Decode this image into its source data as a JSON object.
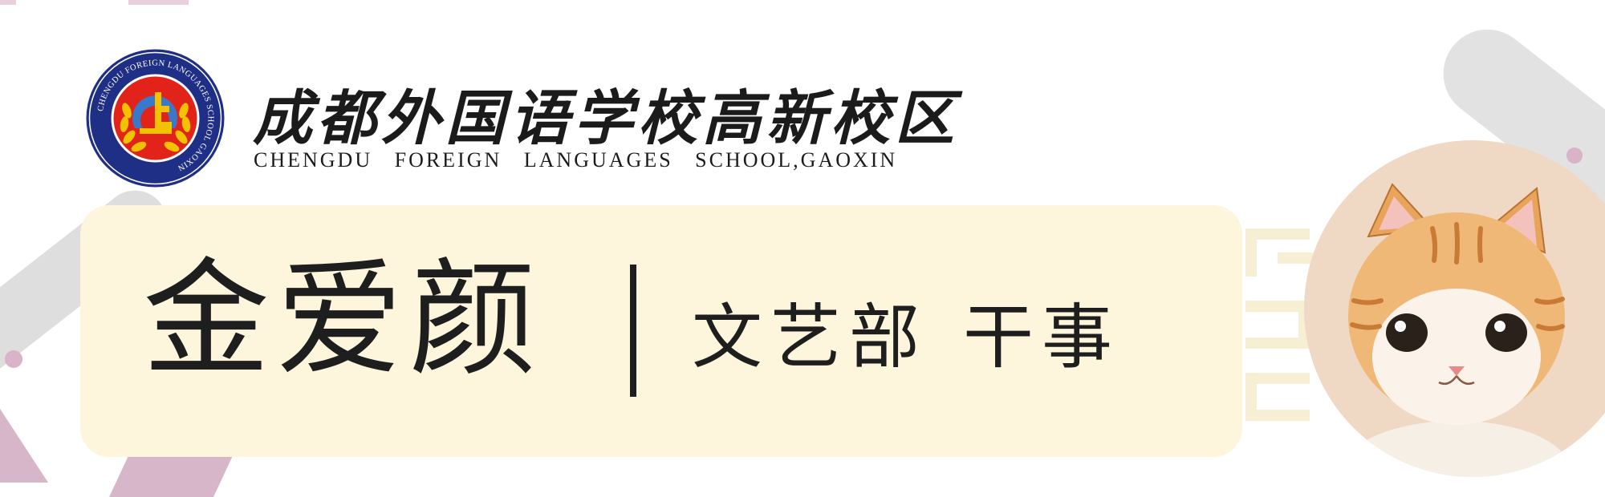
{
  "school": {
    "name_cn": "成都外国语学校高新校区",
    "name_en": "CHENGDU FOREIGN LANGUAGES SCHOOL,GAOXIN"
  },
  "logo": {
    "ring_text": "CHENGDU FOREIGN LANGUAGES SCHOOL GAOXIN",
    "ring_text_cn": "成都外国语学校高新校区",
    "colors": {
      "ring": "#1f2f86",
      "inner": "#e2231a",
      "wreath": "#f2c200",
      "emblem": "#3a78c9"
    }
  },
  "card": {
    "name": "金爱颜",
    "department": "文艺部",
    "position": "干事"
  },
  "avatar": {
    "icon": "cat-icon"
  },
  "colors": {
    "card_bg": "#fdf6dc",
    "accent_pink": "#d8b6c9",
    "gray": "#dedede"
  }
}
